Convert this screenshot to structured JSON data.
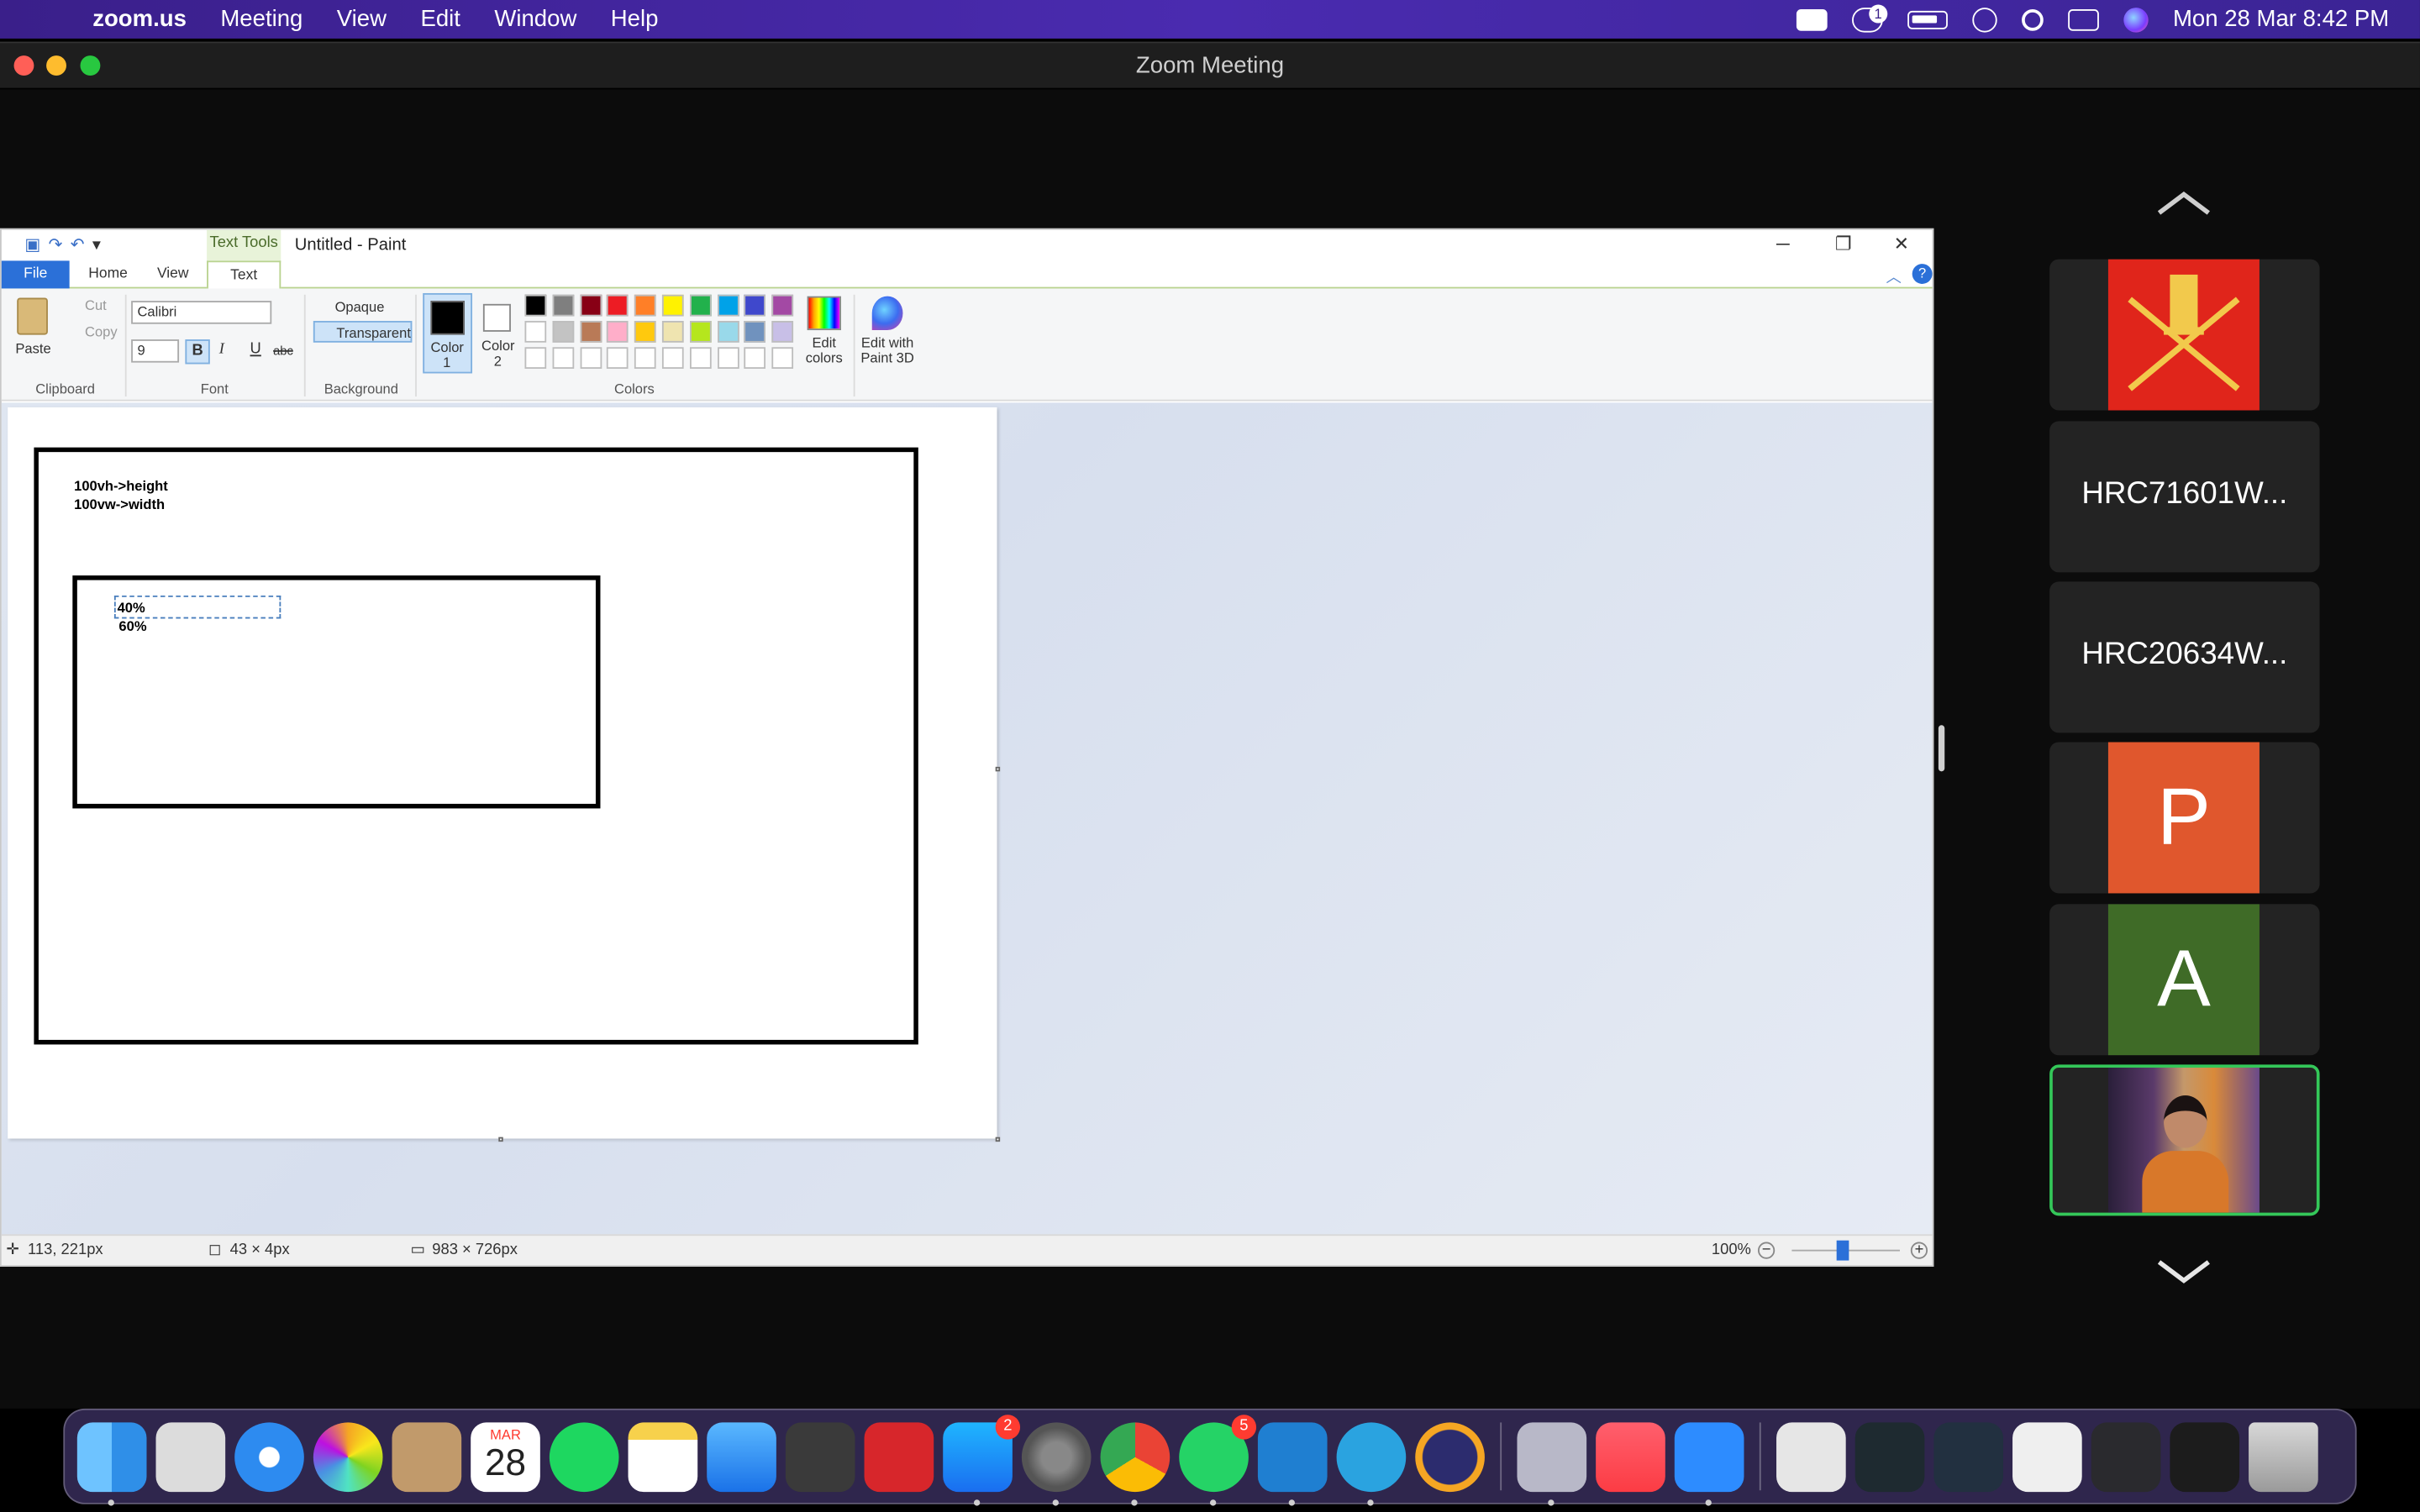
{
  "menubar": {
    "app_name": "zoom.us",
    "items": [
      "Meeting",
      "View",
      "Edit",
      "Window",
      "Help"
    ],
    "datetime": "Mon 28 Mar  8:42 PM",
    "notification_count": "1"
  },
  "zoom": {
    "window_title": "Zoom Meeting"
  },
  "paint": {
    "context_tab": "Text Tools",
    "title": "Untitled - Paint",
    "tabs": {
      "file": "File",
      "home": "Home",
      "view": "View",
      "text": "Text"
    },
    "clipboard": {
      "paste": "Paste",
      "cut": "Cut",
      "copy": "Copy",
      "group": "Clipboard"
    },
    "font": {
      "family": "Calibri",
      "size": "9",
      "bold": "B",
      "italic": "I",
      "underline": "U",
      "strike": "abc",
      "group": "Font"
    },
    "background": {
      "opaque": "Opaque",
      "transparent": "Transparent",
      "group": "Background"
    },
    "colors": {
      "color1_label": "Color",
      "color1_num": "1",
      "color2_label": "Color",
      "color2_num": "2",
      "edit_colors_1": "Edit",
      "edit_colors_2": "colors",
      "edit_paint3d_1": "Edit with",
      "edit_paint3d_2": "Paint 3D",
      "group": "Colors",
      "palette_row1": [
        "#000000",
        "#7f7f7f",
        "#880015",
        "#ed1c24",
        "#ff7f27",
        "#fff200",
        "#22b14c",
        "#00a2e8",
        "#3f48cc",
        "#a349a4"
      ],
      "palette_row2": [
        "#ffffff",
        "#c3c3c3",
        "#b97a57",
        "#ffaec9",
        "#ffc90e",
        "#efe4b0",
        "#b5e61d",
        "#99d9ea",
        "#7092be",
        "#c8bfe7"
      ]
    },
    "canvas_text": {
      "line1": "100vh->height",
      "line2": "100vw->width",
      "box_line1": "40%",
      "box_line2": "60%"
    },
    "status": {
      "cursor": "113, 221px",
      "selection": "43 × 4px",
      "image_size": "983 × 726px",
      "zoom": "100%"
    }
  },
  "participants": [
    {
      "name": "",
      "type": "emblem"
    },
    {
      "name": "HRC71601W...",
      "type": "text"
    },
    {
      "name": "HRC20634W...",
      "type": "text"
    },
    {
      "name": "P",
      "type": "initial",
      "color": "#e0572d"
    },
    {
      "name": "A",
      "type": "initial",
      "color": "#3f6b27"
    },
    {
      "name": "",
      "type": "video"
    }
  ],
  "dock": {
    "calendar_month": "MAR",
    "calendar_day": "28",
    "appstore_badge": "2",
    "whatsapp_badge": "5"
  }
}
